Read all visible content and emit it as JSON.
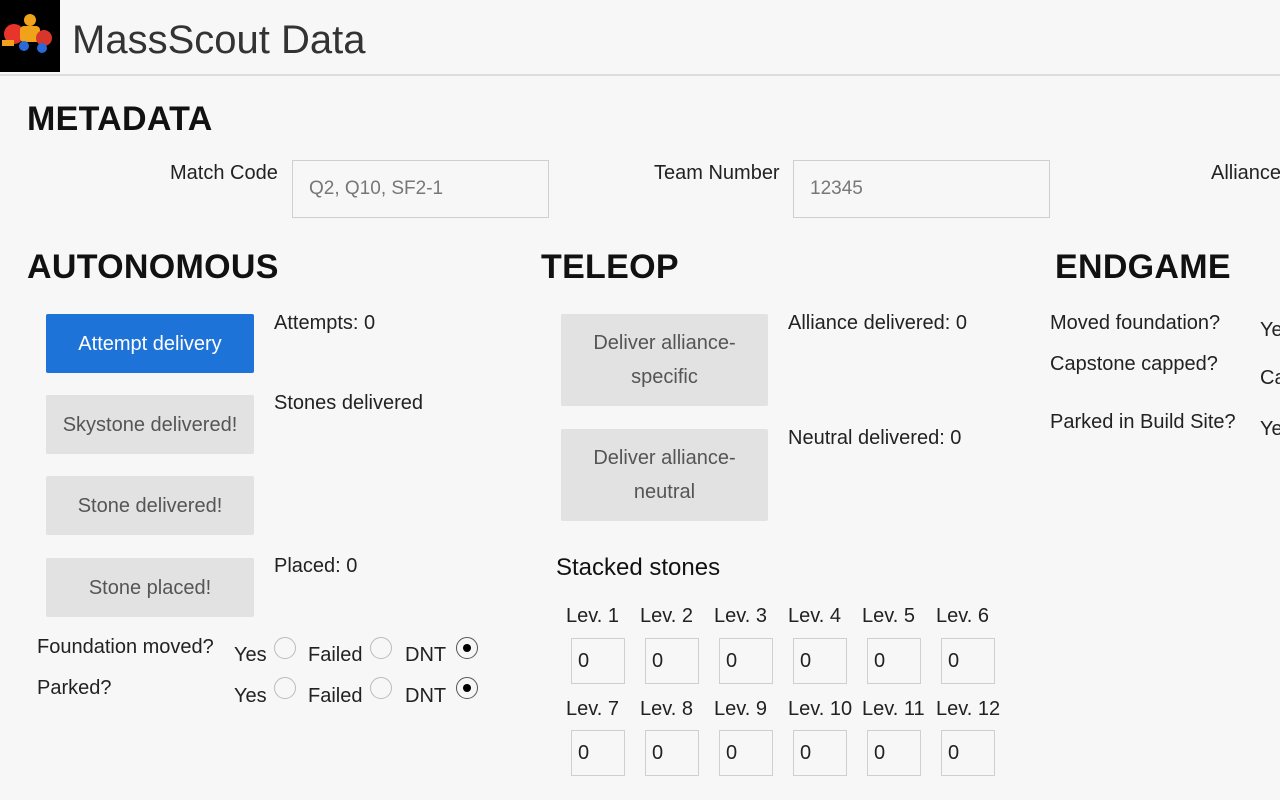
{
  "header": {
    "title": "MassScout Data"
  },
  "metadata": {
    "title": "METADATA",
    "match_code": {
      "label": "Match Code",
      "placeholder": "Q2, Q10, SF2-1"
    },
    "team_number": {
      "label": "Team Number",
      "placeholder": "12345"
    },
    "alliance": {
      "label": "Alliance"
    }
  },
  "autonomous": {
    "title": "AUTONOMOUS",
    "attempt_button": "Attempt delivery",
    "attempts_label": "Attempts: 0",
    "skystone_button": "Skystone delivered!",
    "stones_delivered_label": "Stones delivered",
    "stone_delivered_button": "Stone delivered!",
    "stone_placed_button": "Stone placed!",
    "placed_label": "Placed: 0",
    "foundation_label": "Foundation moved?",
    "parked_label": "Parked?",
    "options": {
      "yes": "Yes",
      "failed": "Failed",
      "dnt": "DNT"
    },
    "foundation_selected": "DNT",
    "parked_selected": "DNT"
  },
  "teleop": {
    "title": "TELEOP",
    "alliance_button": "Deliver alliance-specific",
    "alliance_label": "Alliance delivered: 0",
    "neutral_button": "Deliver alliance-neutral",
    "neutral_label": "Neutral delivered: 0",
    "stacked_title": "Stacked stones",
    "levels": [
      {
        "label": "Lev. 1",
        "value": "0"
      },
      {
        "label": "Lev. 2",
        "value": "0"
      },
      {
        "label": "Lev. 3",
        "value": "0"
      },
      {
        "label": "Lev. 4",
        "value": "0"
      },
      {
        "label": "Lev. 5",
        "value": "0"
      },
      {
        "label": "Lev. 6",
        "value": "0"
      },
      {
        "label": "Lev. 7",
        "value": "0"
      },
      {
        "label": "Lev. 8",
        "value": "0"
      },
      {
        "label": "Lev. 9",
        "value": "0"
      },
      {
        "label": "Lev. 10",
        "value": "0"
      },
      {
        "label": "Lev. 11",
        "value": "0"
      },
      {
        "label": "Lev. 12",
        "value": "0"
      }
    ]
  },
  "endgame": {
    "title": "ENDGAME",
    "moved_foundation_label": "Moved foundation?",
    "moved_foundation_value": "Ye",
    "capstone_label": "Capstone capped?",
    "capstone_value": "Ca",
    "parked_label": "Parked in Build Site?",
    "parked_value": "Ye"
  },
  "colors": {
    "primary": "#1e73d8",
    "button_gray": "#e2e2e2",
    "background": "#f7f7f7"
  }
}
